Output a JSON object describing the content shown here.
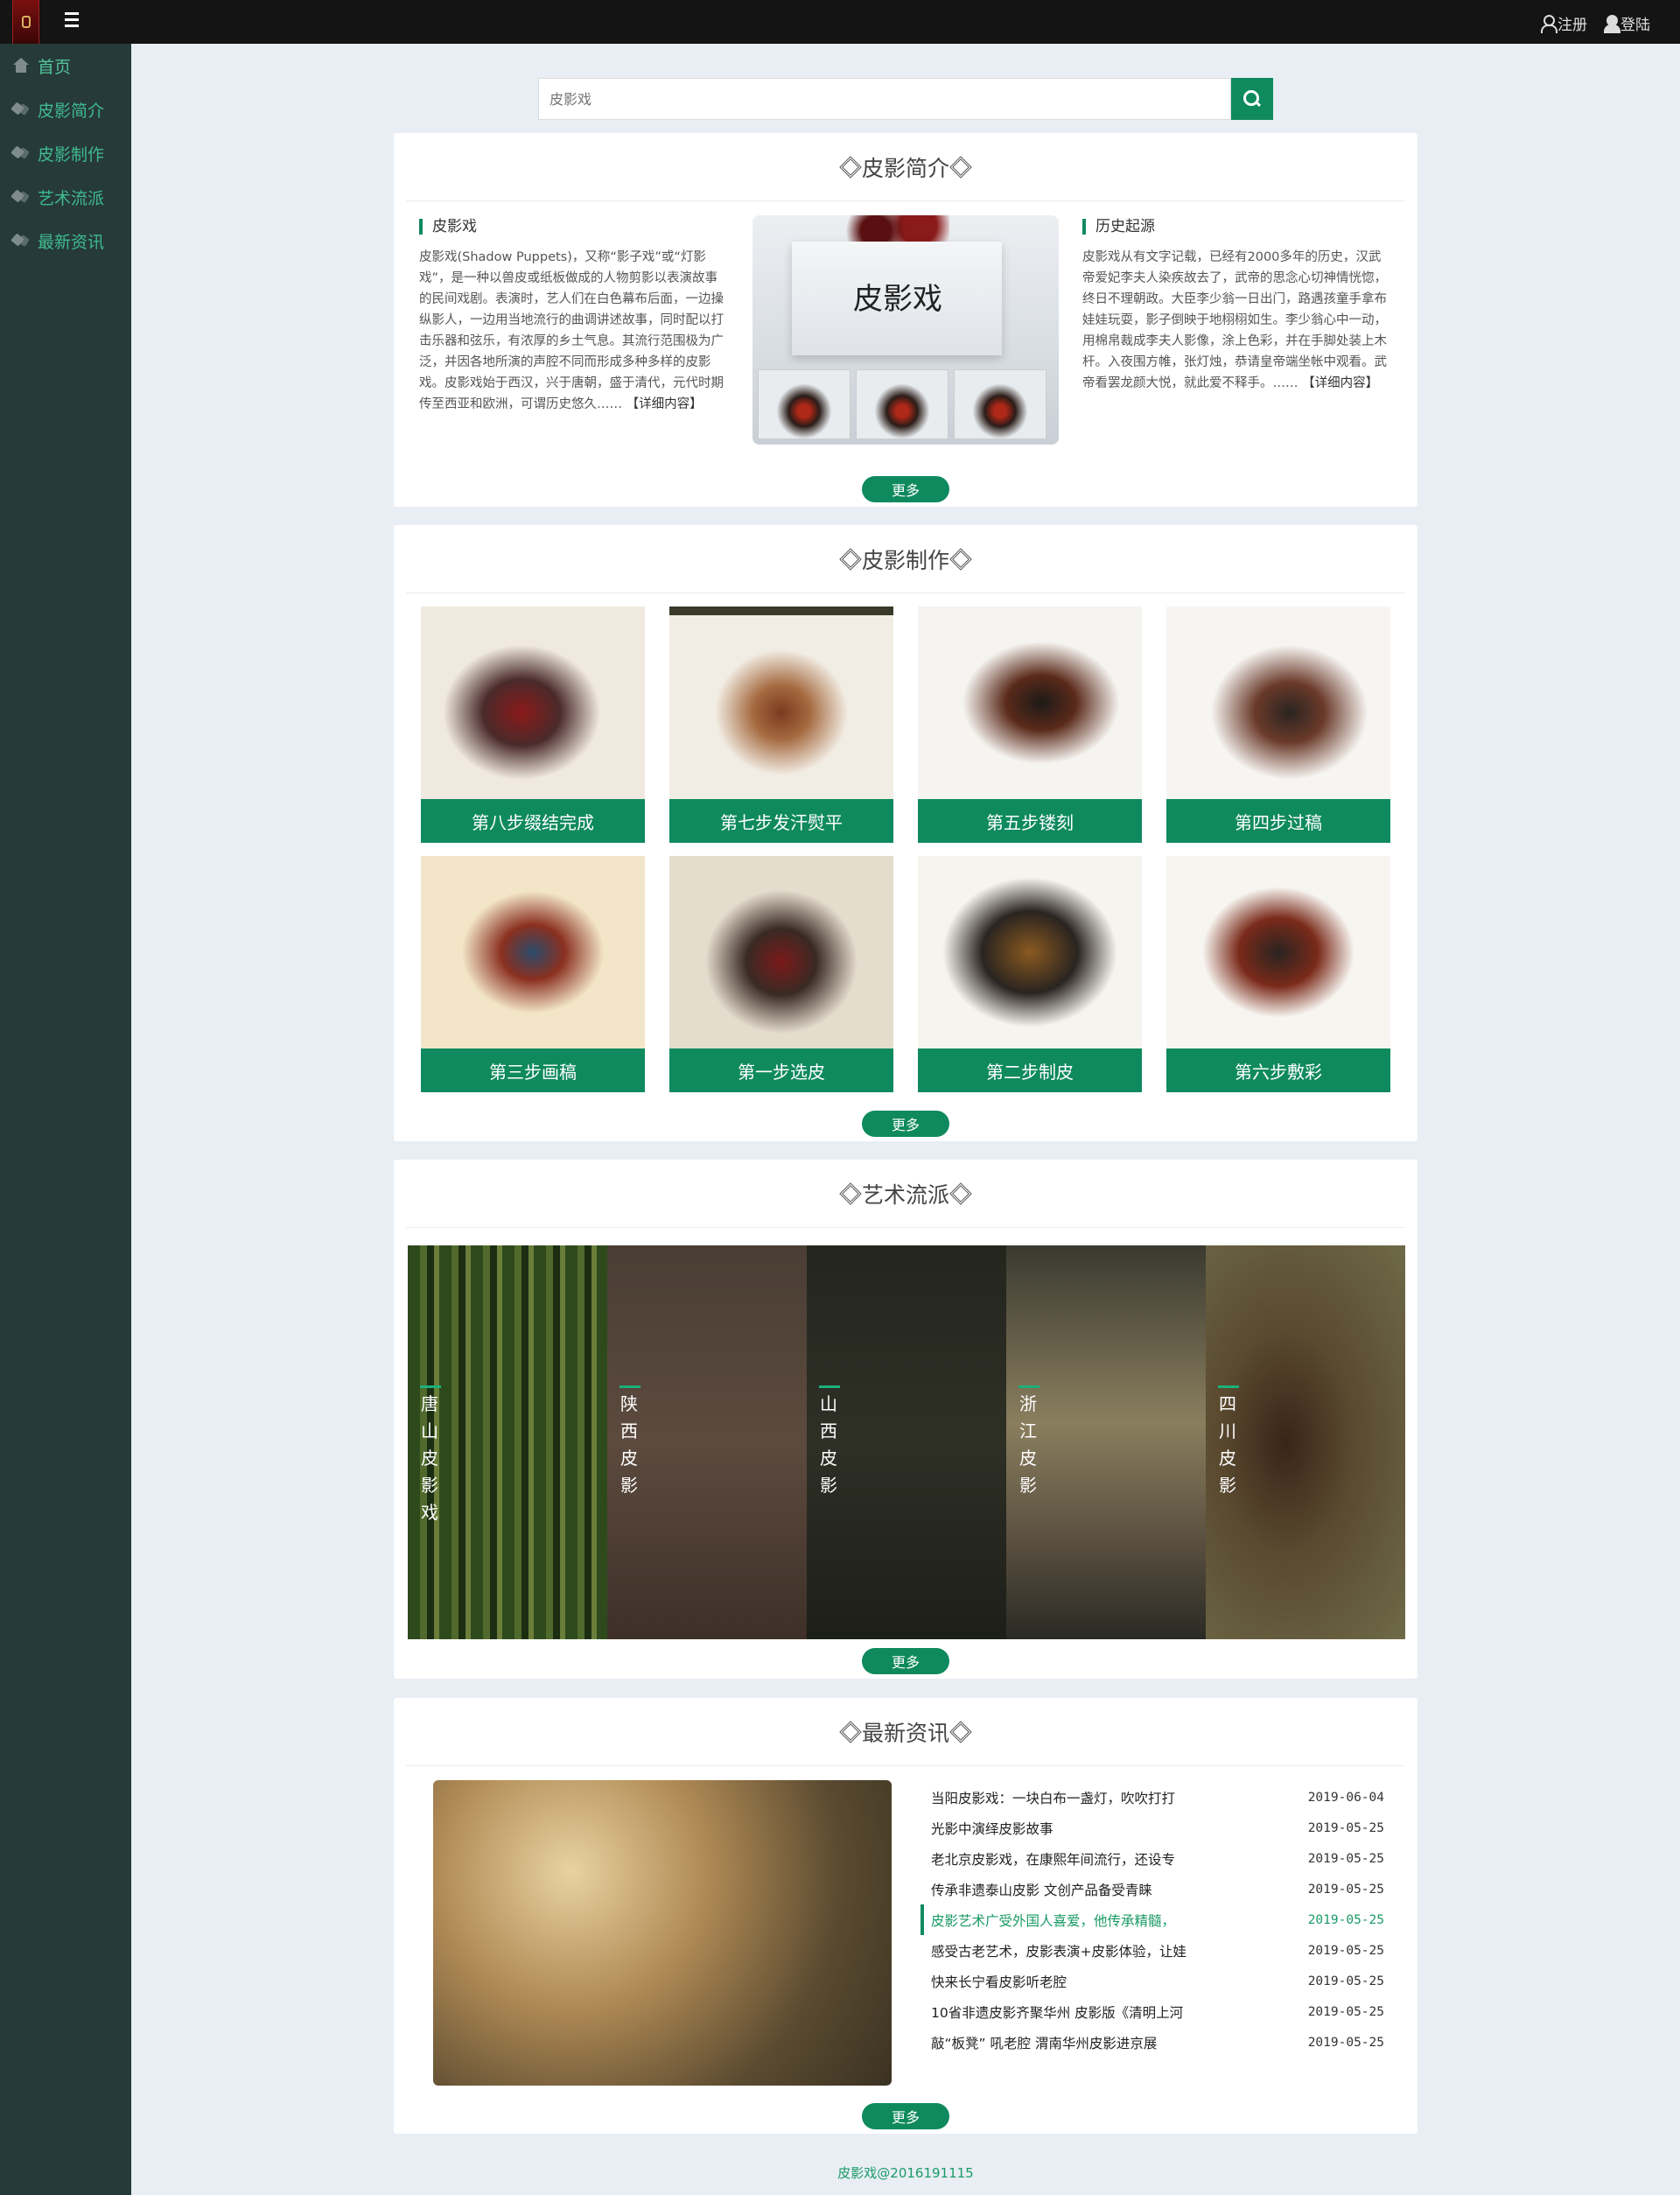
{
  "topbar": {
    "register": "注册",
    "login": "登陆"
  },
  "sidebar": {
    "items": [
      {
        "label": "首页",
        "icon": "home-icon"
      },
      {
        "label": "皮影简介",
        "icon": "tags-icon"
      },
      {
        "label": "皮影制作",
        "icon": "tags-icon"
      },
      {
        "label": "艺术流派",
        "icon": "tags-icon"
      },
      {
        "label": "最新资讯",
        "icon": "tags-icon"
      }
    ]
  },
  "search": {
    "placeholder": "皮影戏"
  },
  "intro": {
    "title": "皮影简介",
    "left_heading": "皮影戏",
    "left_text": "皮影戏(Shadow Puppets)，又称“影子戏”或“灯影戏”，是一种以兽皮或纸板做成的人物剪影以表演故事的民间戏剧。表演时，艺人们在白色幕布后面，一边操纵影人，一边用当地流行的曲调讲述故事，同时配以打击乐器和弦乐，有浓厚的乡土气息。其流行范围极为广泛，并因各地所演的声腔不同而形成多种多样的皮影戏。皮影戏始于西汉，兴于唐朝，盛于清代，元代时期传至西亚和欧洲，可谓历史悠久……",
    "left_link": "【详细内容】",
    "image_title": "皮影戏",
    "right_heading": "历史起源",
    "right_text": "皮影戏从有文字记载，已经有2000多年的历史，汉武帝爱妃李夫人染疾故去了，武帝的思念心切神情恍惚，终日不理朝政。大臣李少翁一日出门，路遇孩童手拿布娃娃玩耍，影子倒映于地栩栩如生。李少翁心中一动，用棉帛裁成李夫人影像，涂上色彩，并在手脚处装上木杆。入夜围方帷，张灯烛，恭请皇帝端坐帐中观看。武帝看罢龙颜大悦，就此爱不释手。……",
    "right_link": "【详细内容】",
    "more": "更多"
  },
  "craft": {
    "title": "皮影制作",
    "items": [
      {
        "caption": "第八步缀结完成"
      },
      {
        "caption": "第七步发汗熨平"
      },
      {
        "caption": "第五步镂刻"
      },
      {
        "caption": "第四步过稿"
      },
      {
        "caption": "第三步画稿"
      },
      {
        "caption": "第一步选皮"
      },
      {
        "caption": "第二步制皮"
      },
      {
        "caption": "第六步敷彩"
      }
    ],
    "more": "更多"
  },
  "schools": {
    "title": "艺术流派",
    "items": [
      {
        "name": "唐山皮影戏"
      },
      {
        "name": "陕西皮影"
      },
      {
        "name": "山西皮影"
      },
      {
        "name": "浙江皮影"
      },
      {
        "name": "四川皮影"
      }
    ],
    "more": "更多"
  },
  "news": {
    "title": "最新资讯",
    "items": [
      {
        "title": "当阳皮影戏：一块白布一盏灯，吹吹打打",
        "date": "2019-06-04"
      },
      {
        "title": "光影中演绎皮影故事",
        "date": "2019-05-25"
      },
      {
        "title": "老北京皮影戏，在康熙年间流行，还设专",
        "date": "2019-05-25"
      },
      {
        "title": "传承非遗泰山皮影 文创产品备受青睐",
        "date": "2019-05-25"
      },
      {
        "title": "皮影艺术广受外国人喜爱，他传承精髓，",
        "date": "2019-05-25",
        "active": true
      },
      {
        "title": "感受古老艺术，皮影表演+皮影体验，让娃",
        "date": "2019-05-25"
      },
      {
        "title": "快来长宁看皮影听老腔",
        "date": "2019-05-25"
      },
      {
        "title": "10省非遗皮影齐聚华州 皮影版《清明上河",
        "date": "2019-05-25"
      },
      {
        "title": "敲“板凳” 吼老腔 渭南华州皮影进京展",
        "date": "2019-05-25"
      }
    ],
    "more": "更多"
  },
  "footer": {
    "text": "皮影戏@2016191115"
  },
  "colors": {
    "accent": "#0f8a5e",
    "sidebar": "#263a3a",
    "topbar": "#141414",
    "background": "#e8eef4"
  }
}
